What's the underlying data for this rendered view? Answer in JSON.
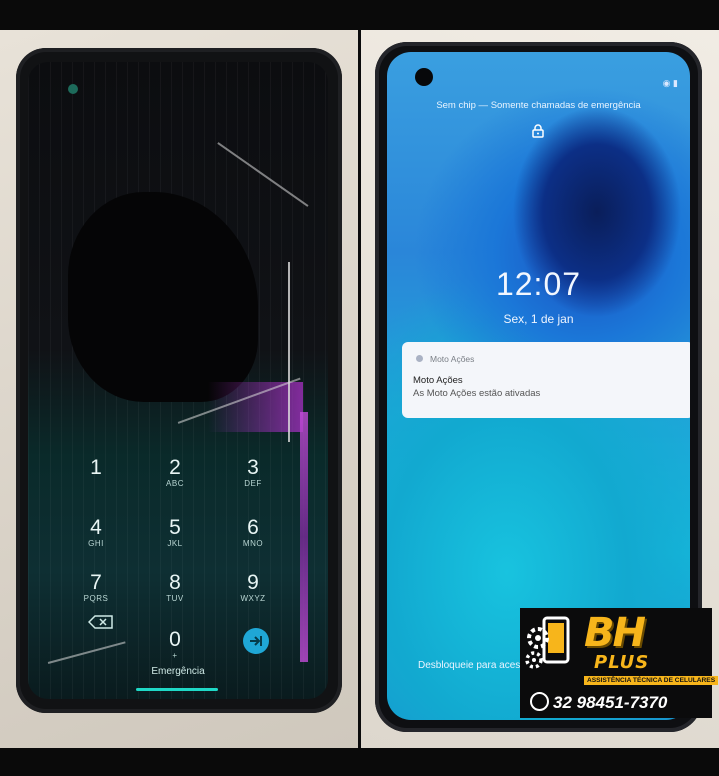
{
  "left_phone": {
    "keypad": [
      {
        "digit": "1",
        "letters": ""
      },
      {
        "digit": "2",
        "letters": "ABC"
      },
      {
        "digit": "3",
        "letters": "DEF"
      },
      {
        "digit": "4",
        "letters": "GHI"
      },
      {
        "digit": "5",
        "letters": "JKL"
      },
      {
        "digit": "6",
        "letters": "MNO"
      },
      {
        "digit": "7",
        "letters": "PQRS"
      },
      {
        "digit": "8",
        "letters": "TUV"
      },
      {
        "digit": "9",
        "letters": "WXYZ"
      },
      {
        "digit": "0",
        "letters": "+"
      }
    ],
    "emergency_label": "Emergência",
    "icons": [
      "backspace-icon",
      "enter-icon"
    ]
  },
  "right_phone": {
    "status_text": "Sem chip — Somente chamadas de emergência",
    "time": "12:07",
    "date": "Sex, 1 de jan",
    "notification": {
      "app": "Moto Ações",
      "title": "Moto Ações",
      "body": "As Moto Ações estão ativadas"
    },
    "unlock_hint": "Desbloqueie para aces",
    "icons": [
      "lock-icon",
      "rotate-icon",
      "battery-icon"
    ]
  },
  "logo": {
    "brand": "BH",
    "brand_sub": "PLUS",
    "tagline": "ASSISTÊNCIA TÉCNICA DE CELULARES",
    "phone": "32 98451-7370",
    "accent": "#f7b51b"
  }
}
